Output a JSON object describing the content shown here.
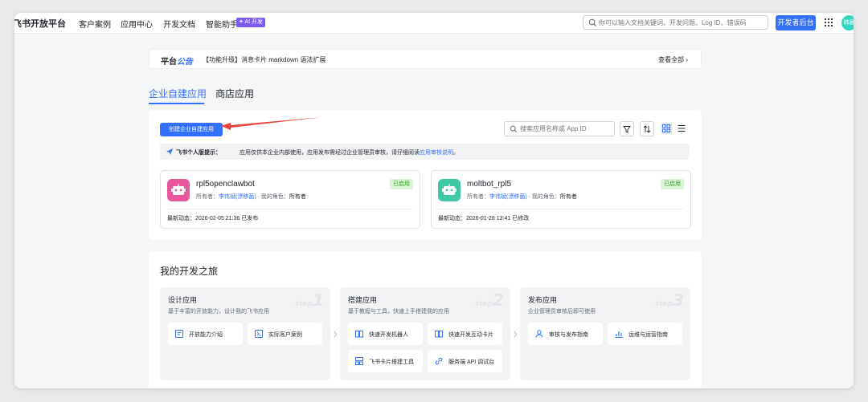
{
  "nav": {
    "brand": "飞书开放平台",
    "items": [
      "客户案例",
      "应用中心",
      "开发文档",
      "智能助手"
    ],
    "ai_badge": "✦ AI 开发",
    "search_placeholder": "你可以输入文档关键词、开发问题、Log ID、错误码",
    "dev_console": "开发者后台",
    "avatar_text": "韩晨"
  },
  "announcement": {
    "label_prefix": "平台",
    "label_suffix": "公告",
    "text": "【功能升级】消息卡片 markdown 语法扩展",
    "more": "查看全部 ›"
  },
  "tabs": [
    "企业自建应用",
    "商店应用"
  ],
  "apps_panel": {
    "create_button": "创建企业自建应用",
    "search_placeholder": "搜索应用名称或 App ID",
    "tip_title": "飞书个人版提示：",
    "tip_text": "应用仅供本企业内部使用，应用发布需经过企业管理员审核，请仔细阅读",
    "tip_link": "应用审核说明",
    "tip_end": "。",
    "apps": [
      {
        "name": "rpl5openclawbot",
        "owner_label": "所有者：",
        "owner": "李伟斌(漂移菌)",
        "role_label": "我的角色：",
        "role": "所有者",
        "status": "已启用",
        "latest": "最新动态：2026-02-05 21:36 已发布",
        "icon_color": "#e8579b"
      },
      {
        "name": "moltbot_rpl5",
        "owner_label": "所有者：",
        "owner": "李伟斌(漂移菌)",
        "role_label": "我的角色：",
        "role": "所有者",
        "status": "已启用",
        "latest": "最新动态：2026-01-28 13:41 已修改",
        "icon_color": "#3ec8a6"
      }
    ]
  },
  "journey": {
    "title": "我的开发之旅",
    "stages": [
      {
        "title": "设计应用",
        "desc": "基于丰富的开放能力，设计我的飞书应用",
        "step_word": "step",
        "step_num": "1",
        "items": [
          "开放能力介绍",
          "实际客户案例"
        ]
      },
      {
        "title": "搭建应用",
        "desc": "基于教程与工具，快速上手搭建我的应用",
        "step_word": "step",
        "step_num": "2",
        "items": [
          "快速开发机器人",
          "快速开发互动卡片",
          "飞书卡片搭建工具",
          "服务端 API 调试台"
        ]
      },
      {
        "title": "发布应用",
        "desc": "企业管理员审核后即可使用",
        "step_word": "step",
        "step_num": "3",
        "items": [
          "审核与发布指南",
          "运维与运营指南"
        ]
      }
    ]
  },
  "colors": {
    "accent": "#3370ff",
    "ai_badge": "#7f5bf0",
    "status_bg": "#d9f5d6",
    "status_text": "#2ea121",
    "annotation_arrow": "#e8413c"
  }
}
